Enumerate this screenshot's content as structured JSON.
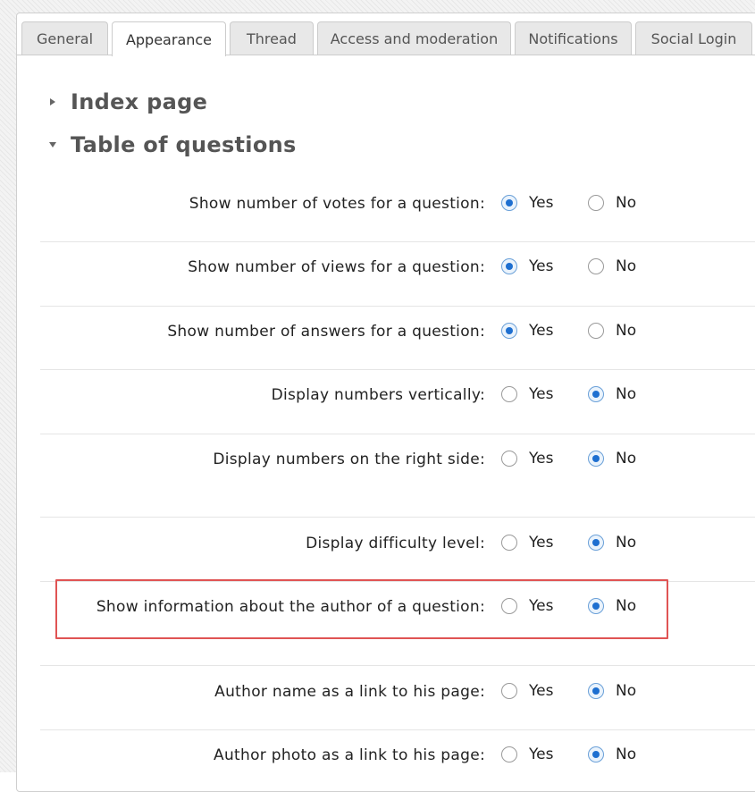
{
  "tabs": [
    {
      "label": "General",
      "active": false
    },
    {
      "label": "Appearance",
      "active": true
    },
    {
      "label": "Thread",
      "active": false
    },
    {
      "label": "Access and moderation",
      "active": false
    },
    {
      "label": "Notifications",
      "active": false
    },
    {
      "label": "Social Login",
      "active": false
    }
  ],
  "sections": [
    {
      "title": "Index page",
      "expanded": false
    },
    {
      "title": "Table of questions",
      "expanded": true
    }
  ],
  "options": {
    "yes": "Yes",
    "no": "No"
  },
  "settings": [
    {
      "label": "Show number of votes for a question:",
      "value": "Yes"
    },
    {
      "label": "Show number of views for a question:",
      "value": "Yes"
    },
    {
      "label": "Show number of answers for a question:",
      "value": "Yes"
    },
    {
      "label": "Display numbers vertically:",
      "value": "No"
    },
    {
      "label": "Display numbers on the right side:",
      "value": "No"
    },
    {
      "label": "Display difficulty level:",
      "value": "No"
    },
    {
      "label": "Show information about the author of a question:",
      "value": "No",
      "highlighted": true
    },
    {
      "label": "Author name as a link to his page:",
      "value": "No"
    },
    {
      "label": "Author photo as a link to his page:",
      "value": "No"
    }
  ],
  "colors": {
    "highlight_border": "#e05454",
    "radio_selected": "#1e6fd0"
  }
}
